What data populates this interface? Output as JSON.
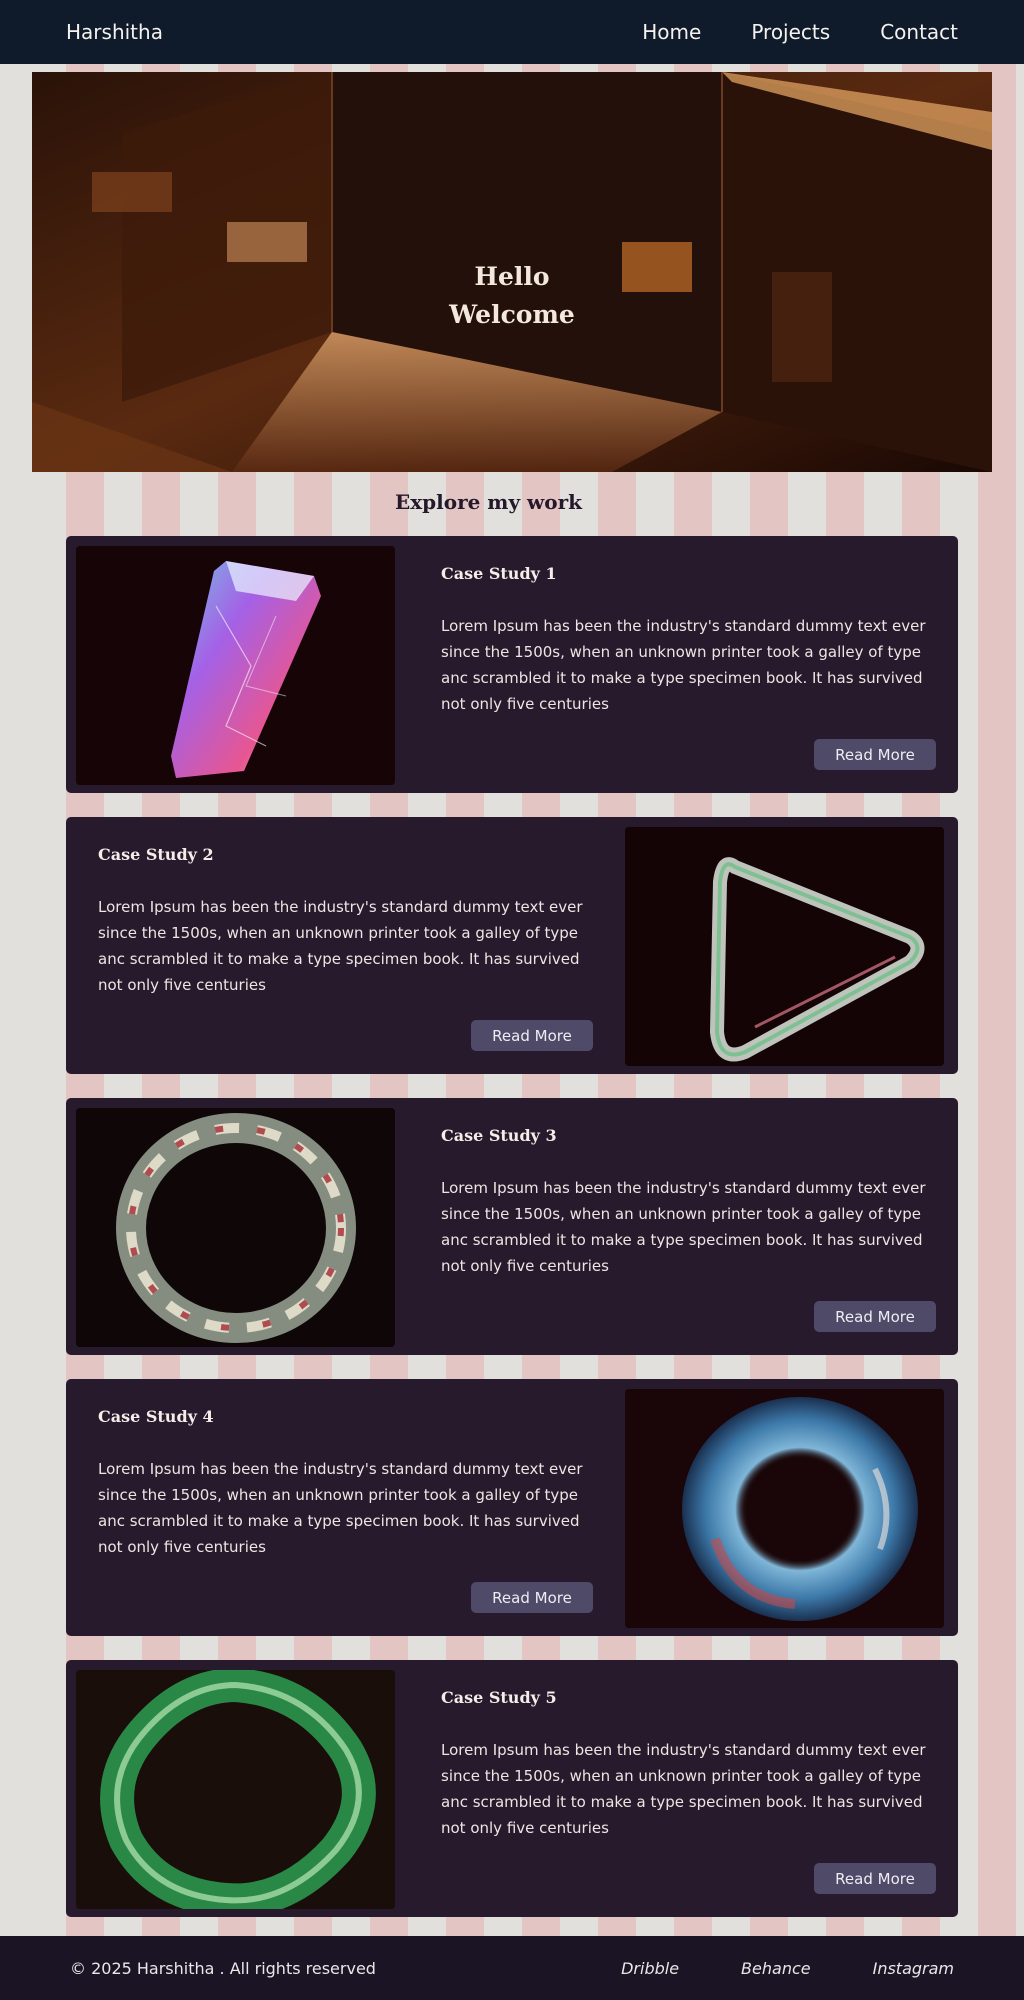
{
  "nav": {
    "brand": "Harshitha",
    "links": [
      "Home",
      "Projects",
      "Contact"
    ]
  },
  "hero": {
    "line1": "Hello",
    "line2": "Welcome"
  },
  "section_title": "Explore my work",
  "cards": [
    {
      "title": "Case Study 1",
      "body": "Lorem Ipsum has been the industry's standard dummy text ever since the 1500s, when an unknown printer took a galley of type anc scrambled it to make a type specimen book. It has survived not only five centuries",
      "button": "Read More",
      "image_icon": "crystal-prism-icon"
    },
    {
      "title": "Case Study 2",
      "body": "Lorem Ipsum has been the industry's standard dummy text ever since the 1500s, when an unknown printer took a galley of type anc scrambled it to make a type specimen book. It has survived not only five centuries",
      "button": "Read More",
      "image_icon": "glass-triangle-icon"
    },
    {
      "title": "Case Study 3",
      "body": "Lorem Ipsum has been the industry's standard dummy text ever since the 1500s, when an unknown printer took a galley of type anc scrambled it to make a type specimen book. It has survived not only five centuries",
      "button": "Read More",
      "image_icon": "twisted-ring-icon"
    },
    {
      "title": "Case Study 4",
      "body": "Lorem Ipsum has been the industry's standard dummy text ever since the 1500s, when an unknown printer took a galley of type anc scrambled it to make a type specimen book. It has survived not only five centuries",
      "button": "Read More",
      "image_icon": "blue-torus-icon"
    },
    {
      "title": "Case Study 5",
      "body": "Lorem Ipsum has been the industry's standard dummy text ever since the 1500s, when an unknown printer took a galley of type anc scrambled it to make a type specimen book. It has survived not only five centuries",
      "button": "Read More",
      "image_icon": "green-knot-icon"
    }
  ],
  "footer": {
    "copyright": "© 2025 Harshitha . All rights reserved",
    "social": [
      "Dribble",
      "Behance",
      "Instagram"
    ]
  },
  "colors": {
    "nav_bg": "#0f1b2a",
    "card_bg": "#271a2d",
    "button_bg": "#4e4a68",
    "page_bg": "#e1e0dc",
    "stripe": "#e3c6c3"
  }
}
